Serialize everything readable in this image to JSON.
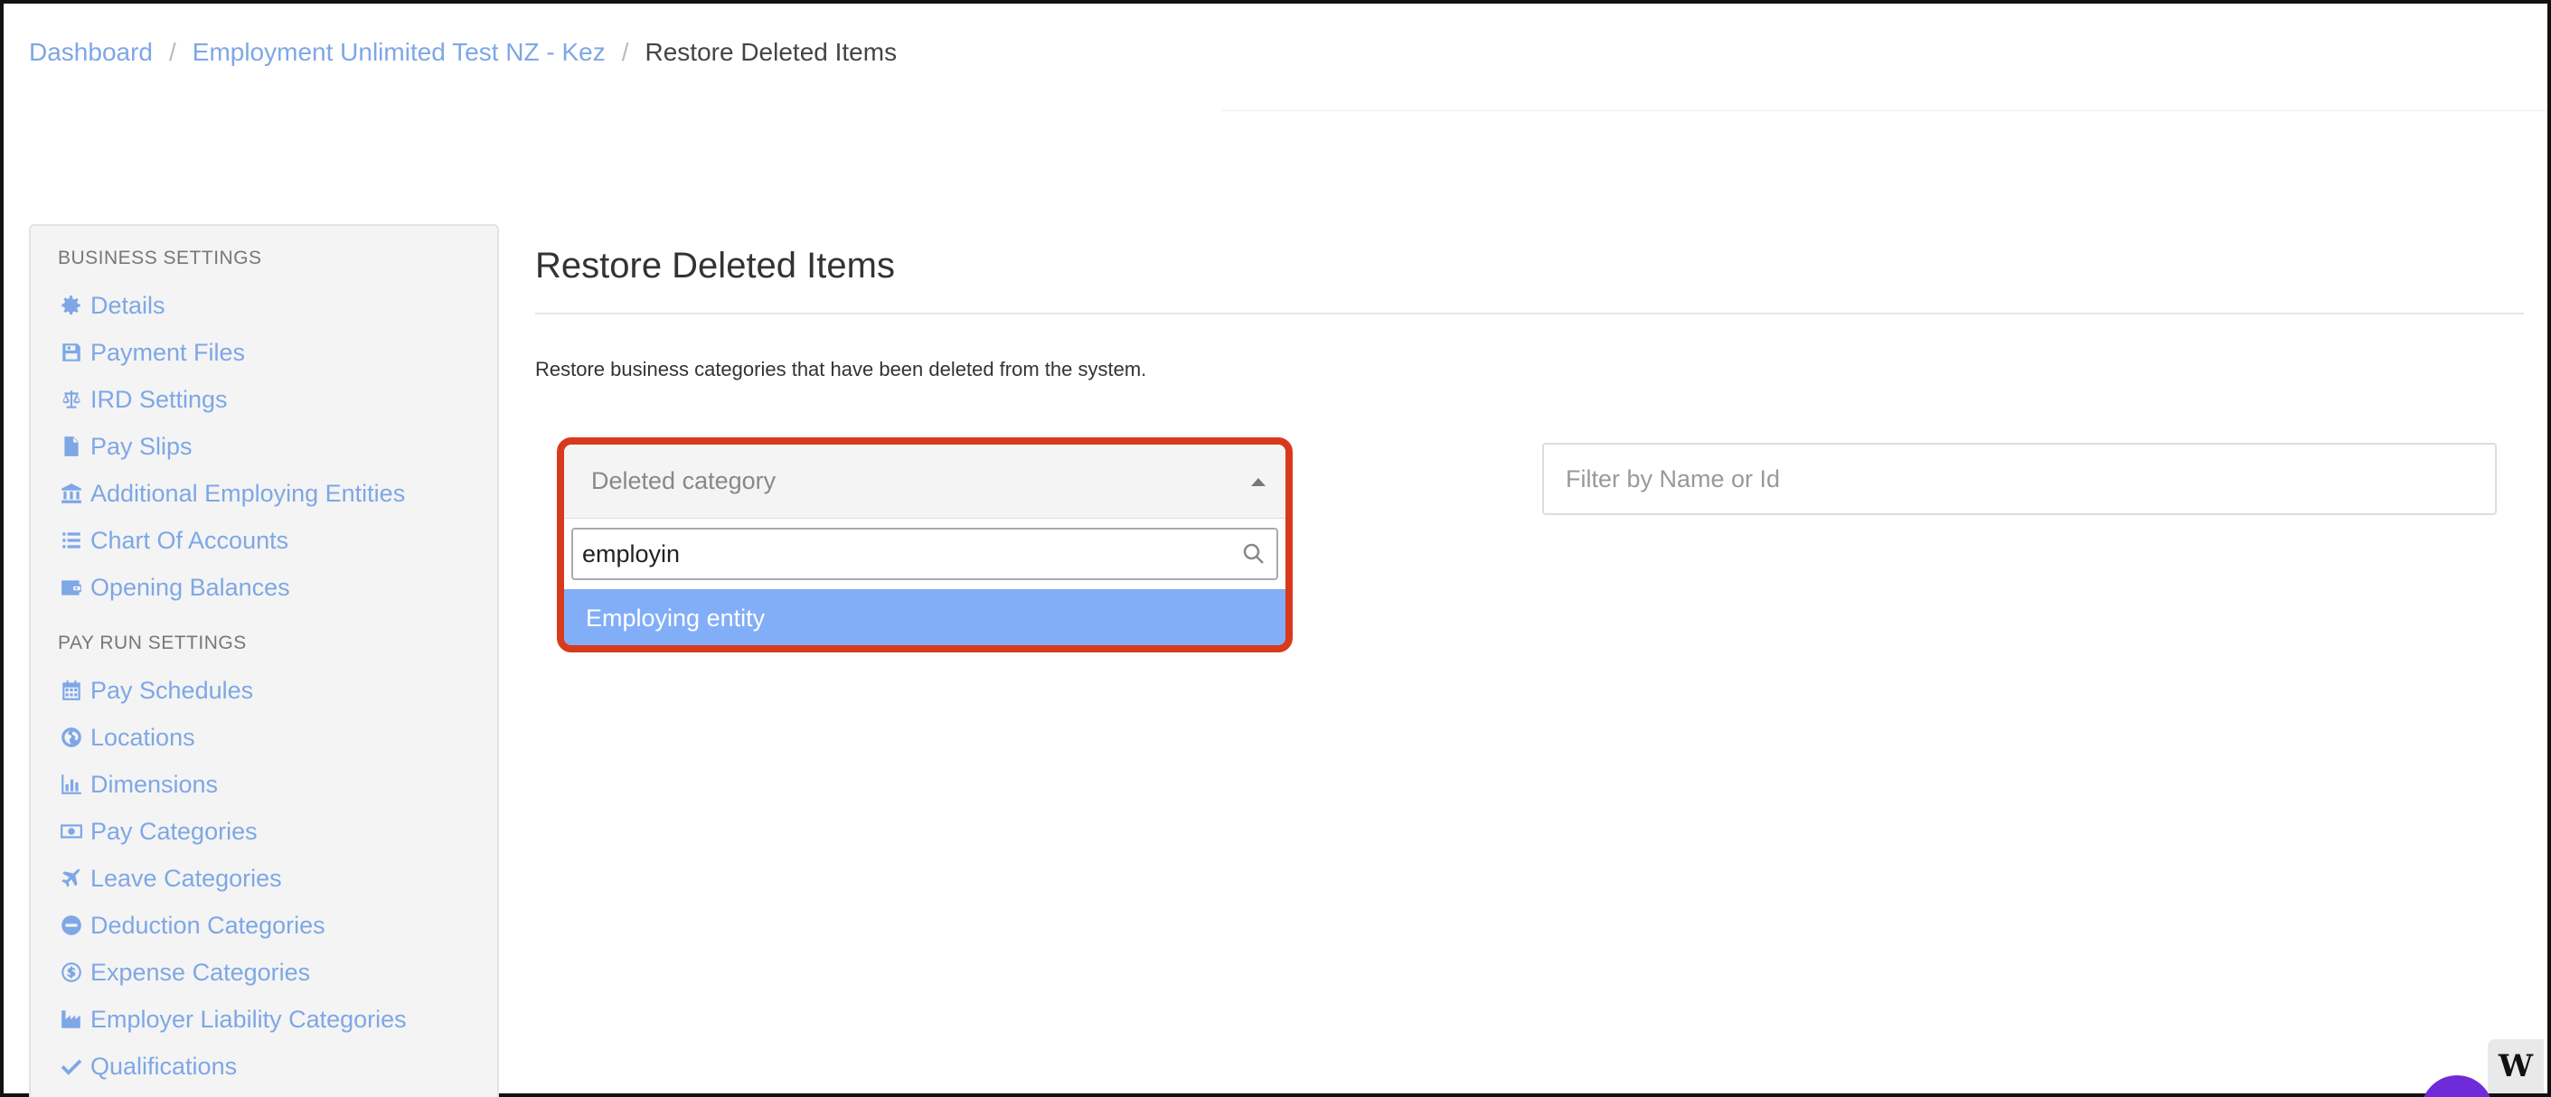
{
  "breadcrumb": {
    "items": [
      "Dashboard",
      "Employment Unlimited Test NZ - Kez"
    ],
    "current": "Restore Deleted Items",
    "separator": "/"
  },
  "sidebar": {
    "business_heading": "BUSINESS SETTINGS",
    "business_items": [
      {
        "label": "Details",
        "icon": "gear-icon"
      },
      {
        "label": "Payment Files",
        "icon": "floppy-disk-icon"
      },
      {
        "label": "IRD Settings",
        "icon": "balance-scale-icon"
      },
      {
        "label": "Pay Slips",
        "icon": "file-icon"
      },
      {
        "label": "Additional Employing Entities",
        "icon": "bank-icon"
      },
      {
        "label": "Chart Of Accounts",
        "icon": "list-icon"
      },
      {
        "label": "Opening Balances",
        "icon": "wallet-icon"
      }
    ],
    "payrun_heading": "PAY RUN SETTINGS",
    "payrun_items": [
      {
        "label": "Pay Schedules",
        "icon": "calendar-icon"
      },
      {
        "label": "Locations",
        "icon": "globe-icon"
      },
      {
        "label": "Dimensions",
        "icon": "bar-chart-icon"
      },
      {
        "label": "Pay Categories",
        "icon": "money-icon"
      },
      {
        "label": "Leave Categories",
        "icon": "plane-icon"
      },
      {
        "label": "Deduction Categories",
        "icon": "minus-circle-icon"
      },
      {
        "label": "Expense Categories",
        "icon": "dollar-circle-icon"
      },
      {
        "label": "Employer Liability Categories",
        "icon": "industry-icon"
      },
      {
        "label": "Qualifications",
        "icon": "check-icon"
      }
    ]
  },
  "main": {
    "title": "Restore Deleted Items",
    "description": "Restore business categories that have been deleted from the system."
  },
  "category_select": {
    "placeholder": "Deleted category",
    "search_value": "employin",
    "options": [
      "Employing entity"
    ]
  },
  "filter": {
    "placeholder": "Filter by Name or Id"
  },
  "corner_widget": {
    "label": "W"
  },
  "colors": {
    "link": "#7ea7e6",
    "highlight_border": "#d9391c",
    "option_highlight": "#82aef7",
    "chat_bubble": "#6d2bd9"
  }
}
